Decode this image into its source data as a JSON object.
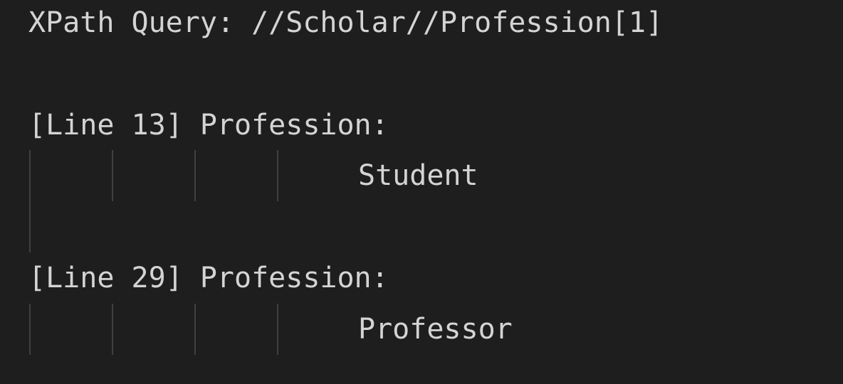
{
  "query": {
    "text": "XPath Query: //Scholar//Profession[1]"
  },
  "results": [
    {
      "header": "[Line 13] Profession:",
      "value": "Student"
    },
    {
      "header": "[Line 29] Profession:",
      "value": "Professor"
    }
  ],
  "colors": {
    "background": "#1e1e1e",
    "text": "#d4d4d4",
    "indent_guide": "#404040"
  }
}
